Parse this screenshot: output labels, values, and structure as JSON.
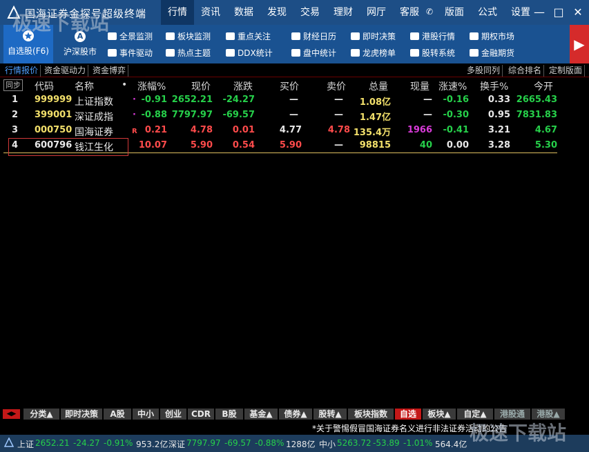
{
  "app": {
    "title": "国海证券金探号超级终端"
  },
  "menu": {
    "items": [
      "行情",
      "资讯",
      "数据",
      "发现",
      "交易",
      "理财",
      "网厅",
      "客服"
    ],
    "items2": [
      "版面",
      "公式",
      "设置"
    ],
    "active": "行情"
  },
  "window": {
    "min": "—",
    "max": "□",
    "close": "✕"
  },
  "toolbar": {
    "fav": "自选股(F6)",
    "sh": "沪深股市",
    "buttons": [
      "全景监测",
      "板块监测",
      "重点关注",
      "财经日历",
      "即时决策",
      "港股行情",
      "期权市场",
      "事件驱动",
      "热点主题",
      "DDX统计",
      "盘中统计",
      "龙虎榜单",
      "股转系统",
      "金融期货"
    ]
  },
  "subtabs": {
    "left": [
      "行情报价",
      "资金驱动力",
      "资金博弈"
    ],
    "right": [
      "多股同列",
      "综合排名",
      "定制版面"
    ]
  },
  "grid": {
    "sync": "同步",
    "headers": [
      "代码",
      "名称",
      "•",
      "涨幅%",
      "现价",
      "涨跌",
      "买价",
      "卖价",
      "总量",
      "现量",
      "涨速%",
      "换手%",
      "今开"
    ],
    "rows": [
      {
        "n": "1",
        "code": "999999",
        "name": "上证指数",
        "flag": "·",
        "pct": "-0.91",
        "price": "2652.21",
        "chg": "-24.27",
        "bid": "—",
        "ask": "—",
        "vol": "1.08亿",
        "cur": "—",
        "spd": "-0.16",
        "turn": "0.33",
        "open": "2665.43"
      },
      {
        "n": "2",
        "code": "399001",
        "name": "深证成指",
        "flag": "·",
        "pct": "-0.88",
        "price": "7797.97",
        "chg": "-69.57",
        "bid": "—",
        "ask": "—",
        "vol": "1.47亿",
        "cur": "—",
        "spd": "-0.30",
        "turn": "0.95",
        "open": "7831.83"
      },
      {
        "n": "3",
        "code": "000750",
        "name": "国海证券",
        "flag": "R",
        "pct": "0.21",
        "price": "4.78",
        "chg": "0.01",
        "bid": "4.77",
        "ask": "4.78",
        "vol": "135.4万",
        "cur": "1966",
        "spd": "-0.41",
        "turn": "3.21",
        "open": "4.67"
      },
      {
        "n": "4",
        "code": "600796",
        "name": "钱江生化",
        "flag": "",
        "pct": "10.07",
        "price": "5.90",
        "chg": "0.54",
        "bid": "5.90",
        "ask": "—",
        "vol": "98815",
        "cur": "40",
        "spd": "0.00",
        "turn": "3.28",
        "open": "5.30"
      }
    ]
  },
  "bottomtabs": [
    "分类▲",
    "即时决策",
    "A股",
    "中小",
    "创业",
    "CDR",
    "B股",
    "基金▲",
    "债券▲",
    "股转▲",
    "板块指数",
    "自选",
    "板块▲",
    "自定▲",
    "港股通",
    "港股▲"
  ],
  "ticker": "*关于警惕假冒国海证券名义进行非法证券活动的公告",
  "status": {
    "sh_label": "上证",
    "sh_val": "2652.21",
    "sh_chg": "-24.27",
    "sh_pct": "-0.91%",
    "sh_amt": "953.2亿",
    "sz_label": "深证",
    "sz_val": "7797.97",
    "sz_chg": "-69.57",
    "sz_pct": "-0.88%",
    "sz_amt": "1288亿",
    "zx_label": "中小",
    "zx_val": "5263.72",
    "zx_chg": "-53.89",
    "zx_pct": "-1.01%",
    "zx_amt": "564.4亿"
  },
  "watermark": "极速下载站"
}
